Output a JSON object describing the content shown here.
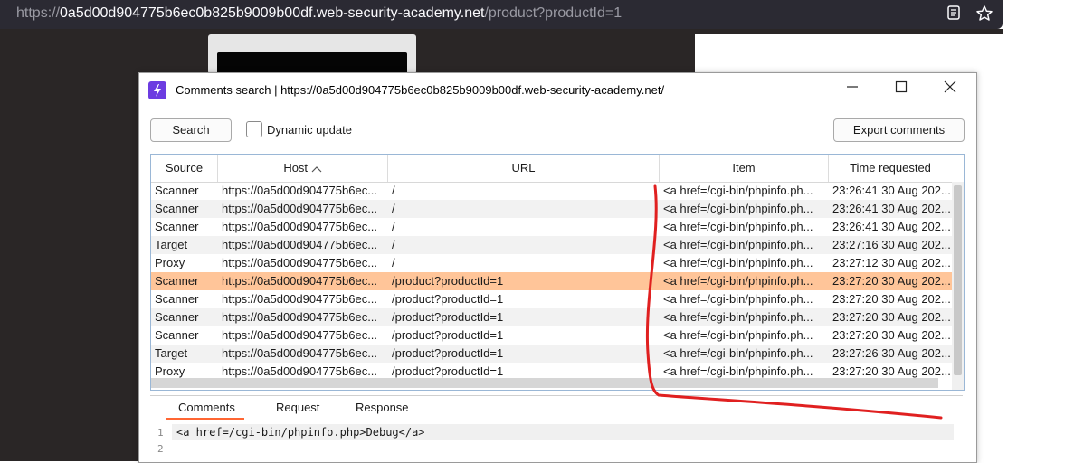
{
  "browser": {
    "url_prefix": "https://",
    "url_domain_highlight": "0a5d00d904775b6ec0b825b9009b00df.web-security-academy.net",
    "url_path": "/product?productId=1",
    "reader_icon": "reader-view-icon",
    "bookmark_icon": "star-icon"
  },
  "dialog": {
    "title": "Comments search | https://0a5d00d904775b6ec0b825b9009b00df.web-security-academy.net/",
    "minimize": "—",
    "maximize": "☐",
    "close": "✕",
    "search_label": "Search",
    "dynamic_update_label": "Dynamic update",
    "export_label": "Export comments"
  },
  "table": {
    "columns": [
      "Source",
      "Host ^",
      "URL",
      "Item",
      "Time requested"
    ],
    "rows": [
      {
        "source": "Scanner",
        "host": "https://0a5d00d904775b6ec...",
        "url": "/",
        "item": "<a href=/cgi-bin/phpinfo.ph...",
        "time": "23:26:41 30 Aug 202..."
      },
      {
        "source": "Scanner",
        "host": "https://0a5d00d904775b6ec...",
        "url": "/",
        "item": "<a href=/cgi-bin/phpinfo.ph...",
        "time": "23:26:41 30 Aug 202..."
      },
      {
        "source": "Scanner",
        "host": "https://0a5d00d904775b6ec...",
        "url": "/",
        "item": "<a href=/cgi-bin/phpinfo.ph...",
        "time": "23:26:41 30 Aug 202..."
      },
      {
        "source": "Target",
        "host": "https://0a5d00d904775b6ec...",
        "url": "/",
        "item": "<a href=/cgi-bin/phpinfo.ph...",
        "time": "23:27:16 30 Aug 202..."
      },
      {
        "source": "Proxy",
        "host": "https://0a5d00d904775b6ec...",
        "url": "/",
        "item": "<a href=/cgi-bin/phpinfo.ph...",
        "time": "23:27:12 30 Aug 202..."
      },
      {
        "source": "Scanner",
        "host": "https://0a5d00d904775b6ec...",
        "url": "/product?productId=1",
        "item": "<a href=/cgi-bin/phpinfo.ph...",
        "time": "23:27:20 30 Aug 202..."
      },
      {
        "source": "Scanner",
        "host": "https://0a5d00d904775b6ec...",
        "url": "/product?productId=1",
        "item": "<a href=/cgi-bin/phpinfo.ph...",
        "time": "23:27:20 30 Aug 202..."
      },
      {
        "source": "Scanner",
        "host": "https://0a5d00d904775b6ec...",
        "url": "/product?productId=1",
        "item": "<a href=/cgi-bin/phpinfo.ph...",
        "time": "23:27:20 30 Aug 202..."
      },
      {
        "source": "Scanner",
        "host": "https://0a5d00d904775b6ec...",
        "url": "/product?productId=1",
        "item": "<a href=/cgi-bin/phpinfo.ph...",
        "time": "23:27:20 30 Aug 202..."
      },
      {
        "source": "Target",
        "host": "https://0a5d00d904775b6ec...",
        "url": "/product?productId=1",
        "item": "<a href=/cgi-bin/phpinfo.ph...",
        "time": "23:27:26 30 Aug 202..."
      },
      {
        "source": "Proxy",
        "host": "https://0a5d00d904775b6ec...",
        "url": "/product?productId=1",
        "item": "<a href=/cgi-bin/phpinfo.ph...",
        "time": "23:27:20 30 Aug 202..."
      }
    ],
    "selected_row_index": 5,
    "selected_color": "#ffc599"
  },
  "detail_tabs": [
    "Comments",
    "Request",
    "Response"
  ],
  "active_tab": "Comments",
  "editor": {
    "line_numbers": [
      "1",
      "2"
    ],
    "line1": "<a href=/cgi-bin/phpinfo.php>Debug</a>"
  },
  "colors": {
    "accent": "#ff6633",
    "annotation": "#e02020",
    "app_icon": "#6c3ce1"
  }
}
